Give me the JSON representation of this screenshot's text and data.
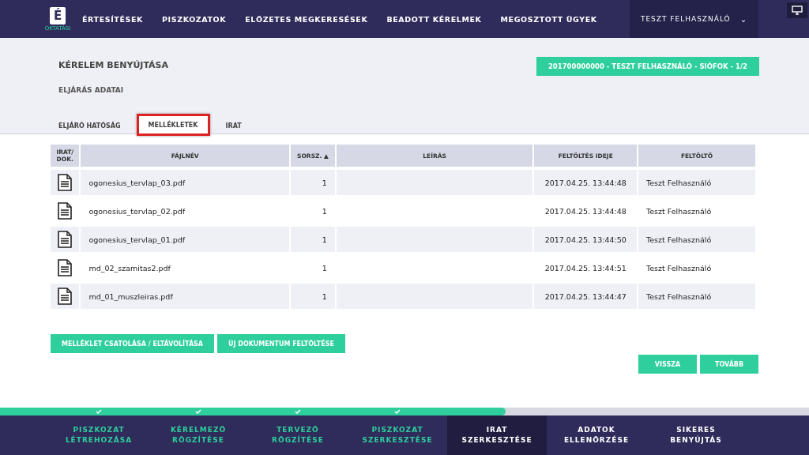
{
  "header": {
    "logo": {
      "letter": "É",
      "caption": "OKTATÁSI"
    },
    "nav": [
      "ÉRTESÍTÉSEK",
      "PISZKOZATOK",
      "ELŐZETES MEGKERESÉSEK",
      "BEADOTT KÉRELMEK",
      "MEGOSZTOTT ÜGYEK"
    ],
    "user": "TESZT FELHASZNÁLÓ",
    "user_caret": "⌄"
  },
  "page": {
    "title": "KÉRELEM BENYÚJTÁSA",
    "subtitle": "ELJÁRÁS ADATAI",
    "case_badge": "201700000000 - TESZT FELHASZNÁLÓ - SIÓFOK - 1/2"
  },
  "tabs": [
    {
      "label": "ELJÁRÓ HATÓSÁG",
      "selected": false
    },
    {
      "label": "MELLÉKLETEK",
      "selected": true
    },
    {
      "label": "IRAT",
      "selected": false
    }
  ],
  "table": {
    "columns": [
      "IRAT/ DOK.",
      "FÁJLNÉV",
      "SORSZ. ▲",
      "LEÍRÁS",
      "FELTÖLTÉS IDEJE",
      "FELTÖLTŐ"
    ],
    "rows": [
      {
        "file": "ogonesius_tervlap_03.pdf",
        "number": "1",
        "uploaded": "2017.04.25. 13:44:48",
        "uploader": "Teszt Felhasználó"
      },
      {
        "file": "ogonesius_tervlap_02.pdf",
        "number": "1",
        "uploaded": "2017.04.25. 13:44:48",
        "uploader": "Teszt Felhasználó"
      },
      {
        "file": "ogonesius_tervlap_01.pdf",
        "number": "1",
        "uploaded": "2017.04.25. 13:44:50",
        "uploader": "Teszt Felhasználó"
      },
      {
        "file": "md_02_szamitas2.pdf",
        "number": "1",
        "uploaded": "2017.04.25. 13:44:51",
        "uploader": "Teszt Felhasználó"
      },
      {
        "file": "md_01_muszleiras.pdf",
        "number": "1",
        "uploaded": "2017.04.25. 13:44:47",
        "uploader": "Teszt Felhasználó"
      }
    ]
  },
  "actions": [
    "MELLÉKLET CSATOLÁSA / ELTÁVOLÍTÁSA",
    "ÚJ DOKUMENTUM FELTÖLTÉSE"
  ],
  "navigation": [
    "VISSZA",
    "TOVÁBB"
  ],
  "progress": {
    "level": 0.625
  },
  "steps": [
    {
      "line1": "PISZKOZAT",
      "line2": "LÉTREHOZÁSA",
      "done": true,
      "selected": false
    },
    {
      "line1": "KÉRELMEZŐ",
      "line2": "RÖGZÍTÉSE",
      "done": true,
      "selected": false
    },
    {
      "line1": "TERVEZŐ",
      "line2": "RÖGZÍTÉSE",
      "done": true,
      "selected": false
    },
    {
      "line1": "PISZKOZAT",
      "line2": "SZERKESZTÉSE",
      "done": true,
      "selected": false
    },
    {
      "line1": "IRAT",
      "line2": "SZERKESZTÉSE",
      "done": false,
      "selected": true
    },
    {
      "line1": "ADATOK",
      "line2": "ELLENŐRZÉSE",
      "done": false,
      "selected": false
    },
    {
      "line1": "SIKERES",
      "line2": "BENYÚJTÁS",
      "done": false,
      "selected": false
    }
  ]
}
